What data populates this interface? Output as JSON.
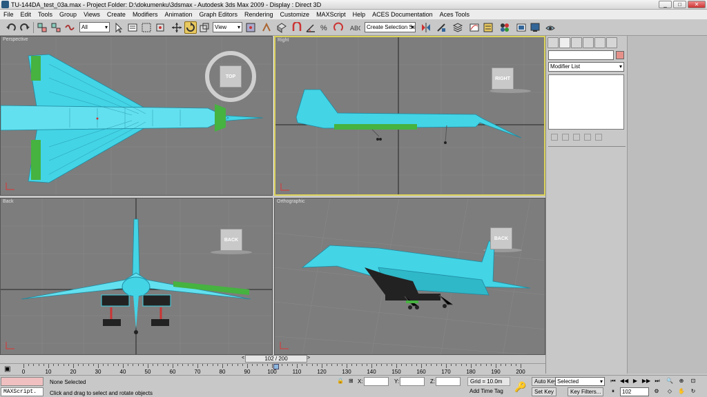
{
  "window": {
    "title": "TU-144DA_test_03a.max    - Project Folder: D:\\dokumenku\\3dsmax    - Autodesk 3ds Max  2009       - Display : Direct 3D",
    "controls": [
      "_",
      "□",
      "✕"
    ]
  },
  "menu": [
    "File",
    "Edit",
    "Tools",
    "Group",
    "Views",
    "Create",
    "Modifiers",
    "Animation",
    "Graph Editors",
    "Rendering",
    "Customize",
    "MAXScript",
    "Help",
    "ACES Documentation",
    "Aces Tools"
  ],
  "toolbar": {
    "filter_value": "All",
    "refcoord_value": "View",
    "selection_set_placeholder": "Create Selection Set"
  },
  "viewports": {
    "perspective": {
      "label": "Perspective",
      "cube": "TOP"
    },
    "right": {
      "label": "Right",
      "cube": "RIGHT"
    },
    "back": {
      "label": "Back",
      "cube": "BACK"
    },
    "orthographic": {
      "label": "Orthographic",
      "cube": "BACK"
    }
  },
  "command_panel": {
    "modifier_list": "Modifier List",
    "color_swatch": "#e5918a"
  },
  "timeslider": {
    "label": "102 / 200",
    "left_arrow": "<",
    "right_arrow": ">"
  },
  "trackbar": {
    "ticks": [
      "0",
      "10",
      "20",
      "30",
      "40",
      "50",
      "60",
      "70",
      "80",
      "90",
      "100",
      "110",
      "120",
      "130",
      "140",
      "150",
      "160",
      "170",
      "180",
      "190",
      "200"
    ]
  },
  "status": {
    "maxscript": "MAXScript.",
    "selection": "None Selected",
    "prompt": "Click and drag to select and rotate objects",
    "x_label": "X:",
    "y_label": "Y:",
    "z_label": "Z:",
    "grid": "Grid = 10.0m",
    "add_time_tag": "Add Time Tag",
    "auto_key": "Auto Key",
    "set_key": "Set Key",
    "selected_option": "Selected",
    "key_filters": "Key Filters...",
    "frame": "102"
  }
}
